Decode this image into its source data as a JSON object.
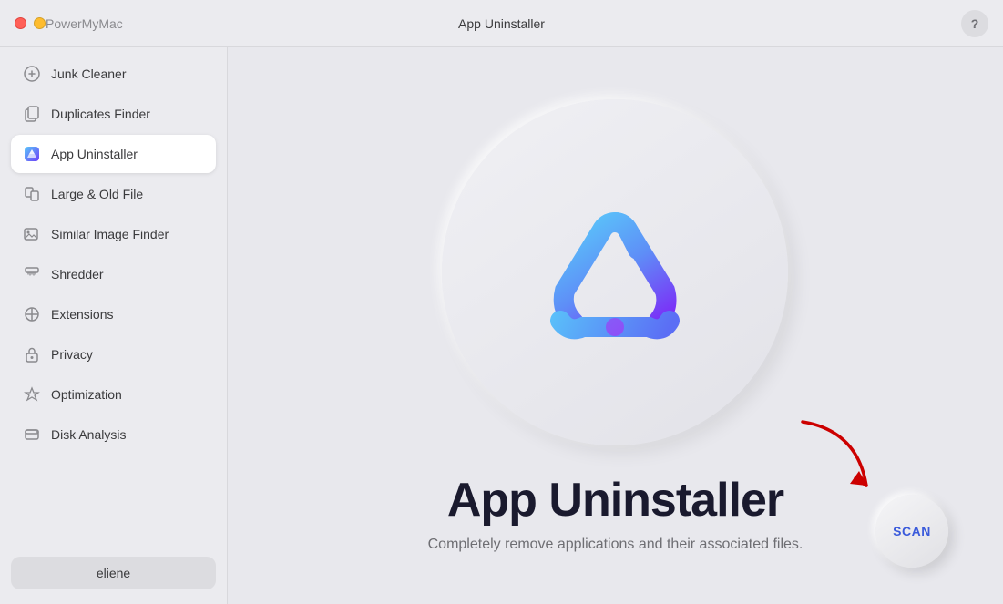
{
  "titlebar": {
    "app_name": "PowerMyMac",
    "page_title": "App Uninstaller",
    "help_label": "?"
  },
  "sidebar": {
    "items": [
      {
        "id": "junk-cleaner",
        "label": "Junk Cleaner",
        "active": false
      },
      {
        "id": "duplicates-finder",
        "label": "Duplicates Finder",
        "active": false
      },
      {
        "id": "app-uninstaller",
        "label": "App Uninstaller",
        "active": true
      },
      {
        "id": "large-old-file",
        "label": "Large & Old File",
        "active": false
      },
      {
        "id": "similar-image-finder",
        "label": "Similar Image Finder",
        "active": false
      },
      {
        "id": "shredder",
        "label": "Shredder",
        "active": false
      },
      {
        "id": "extensions",
        "label": "Extensions",
        "active": false
      },
      {
        "id": "privacy",
        "label": "Privacy",
        "active": false
      },
      {
        "id": "optimization",
        "label": "Optimization",
        "active": false
      },
      {
        "id": "disk-analysis",
        "label": "Disk Analysis",
        "active": false
      }
    ],
    "user_label": "eliene"
  },
  "main": {
    "feature_title": "App Uninstaller",
    "feature_desc": "Completely remove applications and their associated files.",
    "scan_label": "SCAN"
  },
  "colors": {
    "accent": "#3b5bdb",
    "red_arrow": "#cc0000"
  }
}
